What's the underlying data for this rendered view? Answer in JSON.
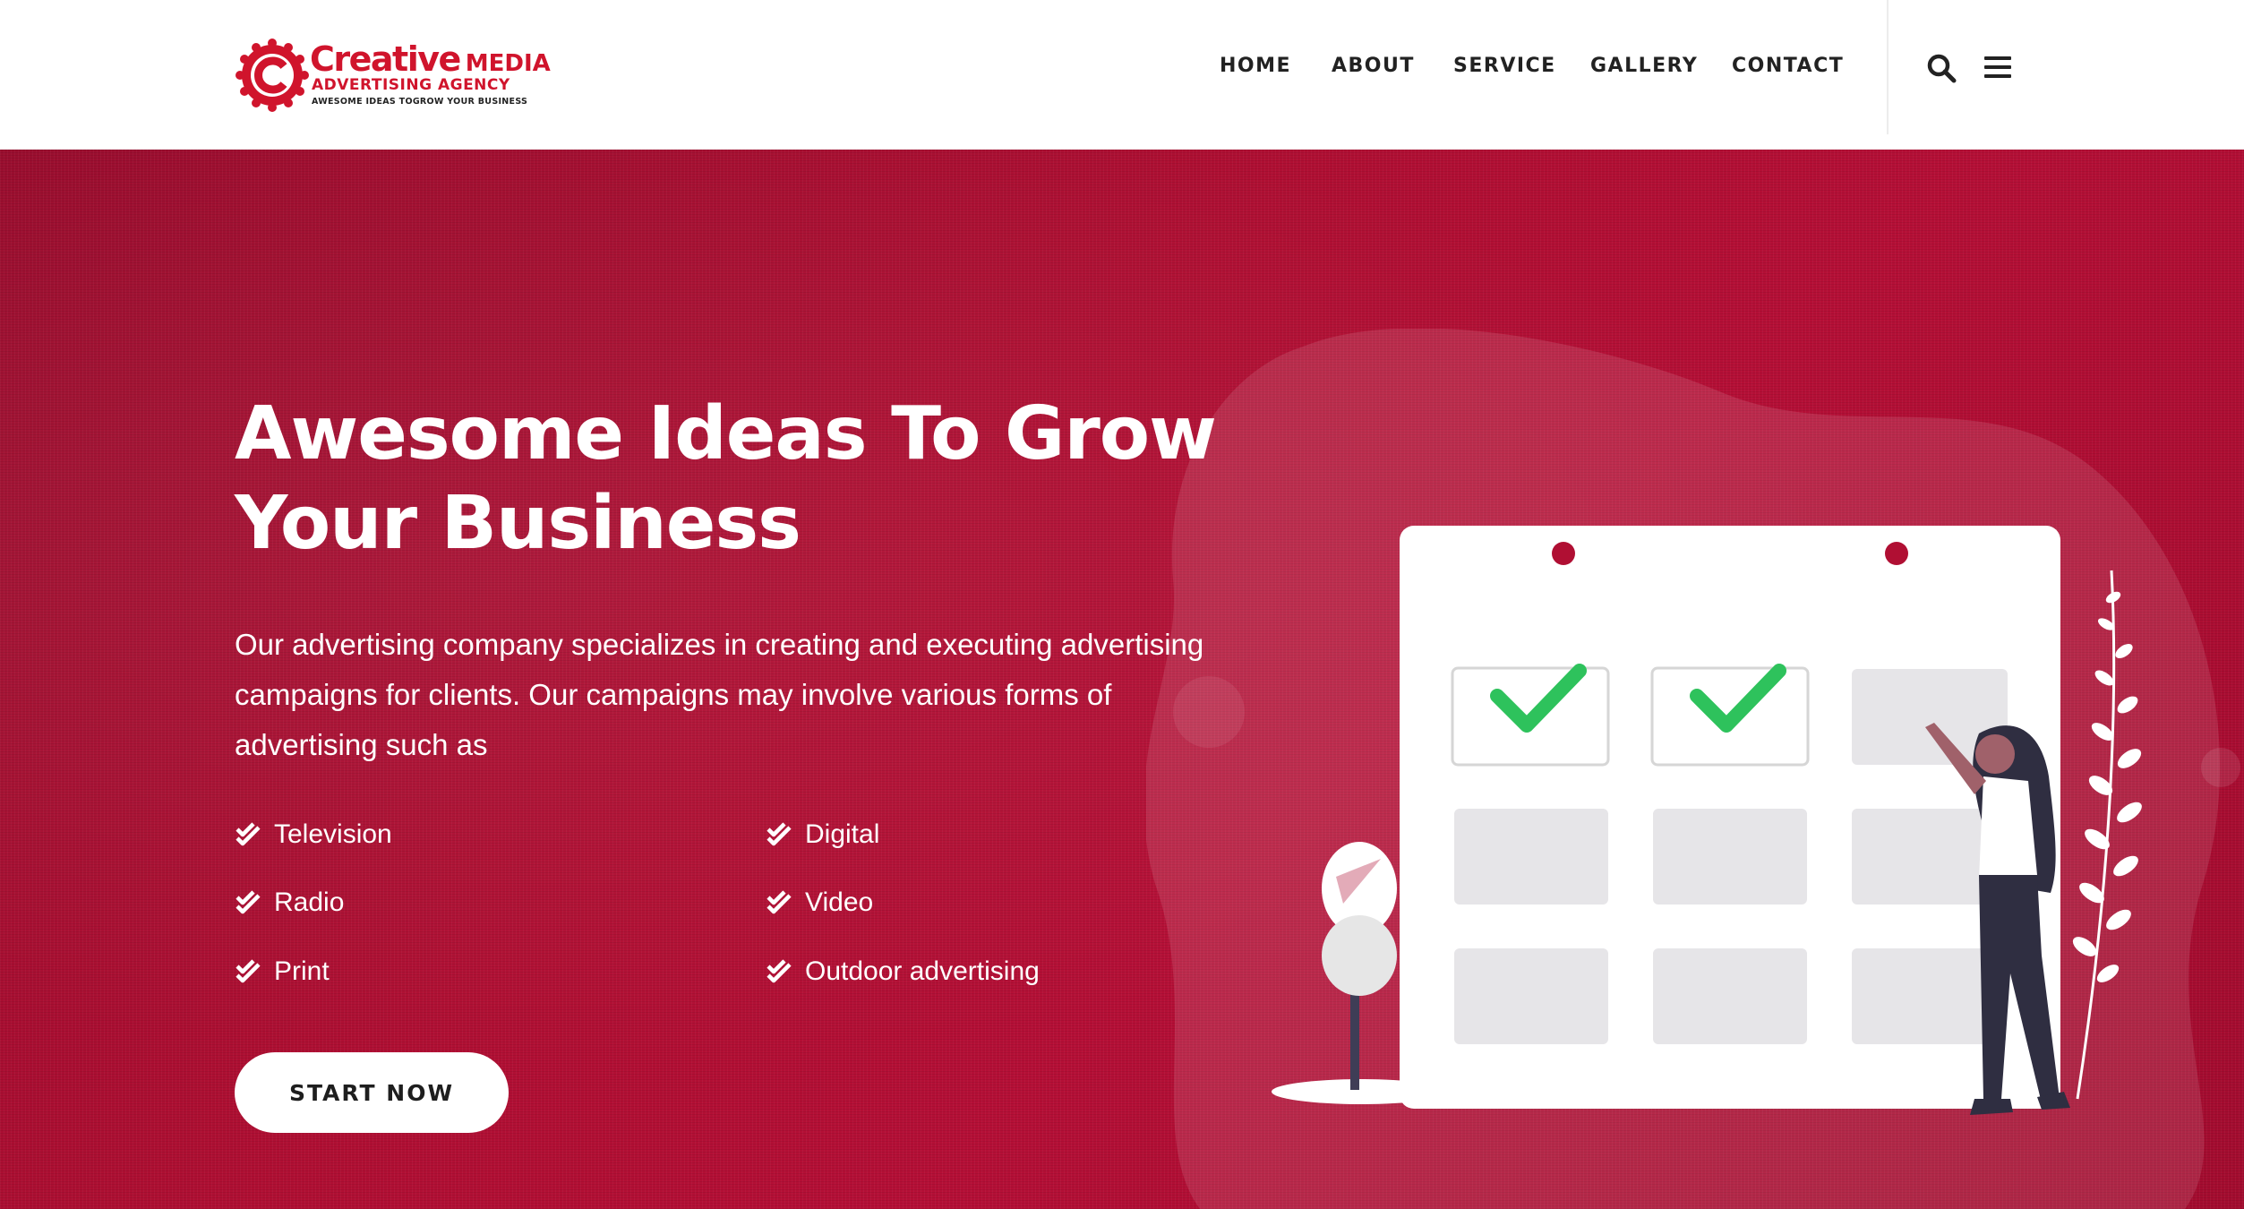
{
  "header": {
    "logo": {
      "word1": "Creative",
      "word2": "MEDIA",
      "line2": "ADVERTISING AGENCY",
      "tagline": "AWESOME IDEAS TOGROW YOUR BUSINESS",
      "brand_color": "#d0142c"
    },
    "nav": [
      {
        "label": "HOME"
      },
      {
        "label": "ABOUT"
      },
      {
        "label": "SERVICE"
      },
      {
        "label": "GALLERY"
      },
      {
        "label": "CONTACT"
      }
    ],
    "icons": [
      "search-icon",
      "hamburger-menu-icon"
    ]
  },
  "hero": {
    "title_line1": "Awesome Ideas To Grow",
    "title_line2": "Your Business",
    "description": "Our advertising company specializes in creating and executing advertising campaigns for clients. Our campaigns may involve various forms of advertising such as",
    "features": [
      {
        "label": "Television"
      },
      {
        "label": "Digital"
      },
      {
        "label": "Radio"
      },
      {
        "label": "Video"
      },
      {
        "label": "Print"
      },
      {
        "label": "Outdoor advertising"
      }
    ],
    "cta_label": "START NOW",
    "background_color": "#b00f33",
    "check_color": "#2ec25c"
  }
}
